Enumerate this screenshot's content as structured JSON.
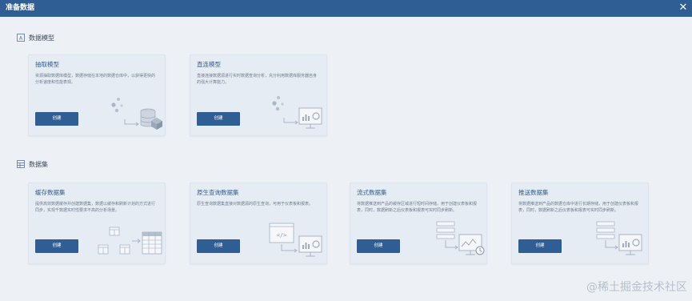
{
  "window": {
    "title": "准备数据",
    "close_icon": "close-icon"
  },
  "sections": [
    {
      "label": "数据模型",
      "icon": "data-model-icon"
    },
    {
      "label": "数据集",
      "icon": "dataset-icon"
    }
  ],
  "model_cards": [
    {
      "title": "抽取模型",
      "description": "资源抽取数据库模型，数据存储在本地的数据仓库中，以获得更快的分析速度和性能表现。",
      "button": "创建"
    },
    {
      "title": "直连模型",
      "description": "直接连接数据源进行实时数据查询分析，充分利用数据库服务器自身的强大计算能力。",
      "button": "创建"
    }
  ],
  "dataset_cards": [
    {
      "title": "缓存数据集",
      "description": "提供高效数据缓存并创建数据集，数据以缓存和刷新计划的方式进行同步，实现千数据实时性要求不高的分析场景。",
      "button": "创建"
    },
    {
      "title": "原生查询数据集",
      "description": "原生查询数据集直接对数据源的原生查询，可用于仪表板和报表。",
      "button": "创建"
    },
    {
      "title": "流式数据集",
      "description": "将数据推送到产品的缓存区域进行短时间存储，用于创建仪表板和报表，同时，数据刷新之后仪表板和报表可实时同步刷新。",
      "button": "创建"
    },
    {
      "title": "推送数据集",
      "description": "将数据推送到产品的数据仓库中进行长期存储，用于创建仪表板和报表，同时，数据刷新之后仪表板和报表可实时同步刷新。",
      "button": "创建"
    }
  ],
  "watermark": "@稀土掘金技术社区",
  "colors": {
    "accent": "#2f5e94",
    "background": "#edf1f6",
    "card": "#e6ecf4",
    "illustration": "#a9b6c6"
  }
}
